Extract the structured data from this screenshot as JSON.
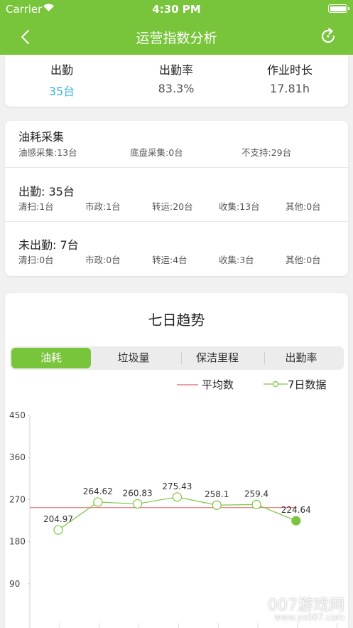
{
  "status_bar": {
    "carrier": "Carrier",
    "time": "4:30 PM"
  },
  "nav": {
    "title": "运营指数分析"
  },
  "summary": [
    {
      "label": "出勤",
      "value": "35台"
    },
    {
      "label": "出勤率",
      "value": "83.3%"
    },
    {
      "label": "作业时长",
      "value": "17.81h"
    }
  ],
  "fuel": {
    "title": "油耗采集",
    "items": [
      "油感采集:13台",
      "底盘采集:0台",
      "不支持:29台"
    ]
  },
  "attendance": {
    "title": "出勤: 35台",
    "items": [
      "清扫:1台",
      "市政:1台",
      "转运:20台",
      "收集:13台",
      "其他:0台"
    ]
  },
  "absence": {
    "title": "未出勤: 7台",
    "items": [
      "清扫:0台",
      "市政:0台",
      "转运:4台",
      "收集:3台",
      "其他:0台"
    ]
  },
  "trend": {
    "title": "七日趋势",
    "tabs": [
      "油耗",
      "垃圾量",
      "保洁里程",
      "出勤率"
    ],
    "active_tab": 0,
    "legend": {
      "average": "平均数",
      "data": "7日数据"
    }
  },
  "chart_data": {
    "type": "line",
    "y_ticks": [
      90,
      180,
      270,
      360,
      450
    ],
    "ylim": [
      0,
      450
    ],
    "values": [
      204.97,
      264.62,
      260.83,
      275.43,
      258.1,
      259.4,
      224.64
    ],
    "value_labels": [
      "204.97",
      "264.62",
      "260.83",
      "275.43",
      "258.1",
      "259.4",
      "224.64"
    ],
    "average": 252.71,
    "colors": {
      "line": "#7cc541",
      "average": "#e06060"
    }
  },
  "watermark": {
    "text": "007游戏网",
    "url": "www.yx007.com"
  },
  "colors": {
    "primary": "#78c43a",
    "accent_blue": "#3ab4d8"
  }
}
